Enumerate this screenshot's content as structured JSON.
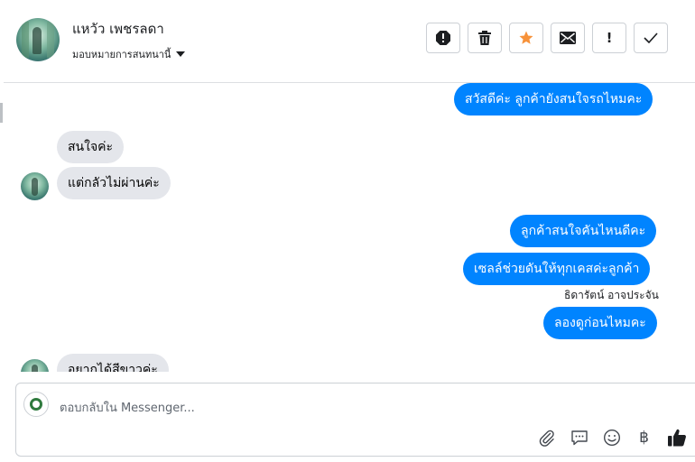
{
  "header": {
    "contact_name": "แหวัว เพชรลดา",
    "assign_label": "มอบหมายการสนทนานี้"
  },
  "actions": [
    {
      "name": "report-icon"
    },
    {
      "name": "trash-icon"
    },
    {
      "name": "star-icon",
      "color": "#f7923a"
    },
    {
      "name": "mail-icon"
    },
    {
      "name": "important-icon",
      "label": "!"
    },
    {
      "name": "check-icon"
    }
  ],
  "messages": {
    "out1": "สวัสดีค่ะ ลูกค้ายังสนใจรถไหมคะ",
    "in1": "สนใจค่ะ",
    "in2": "แต่กลัวไม่ผ่านค่ะ",
    "out2": "ลูกค้าสนใจคันไหนดีคะ",
    "out3": "เซลล์ช่วยดันให้ทุกเคสค่ะลูกค้า",
    "sender": "ธิดารัตน์ อาจประจัน",
    "out4": "ลองดูก่อนไหมคะ",
    "in3": "อยากได้สีขาวค่ะ"
  },
  "composer": {
    "placeholder": "ตอบกลับใน Messenger..."
  },
  "toolbar": {
    "currency_symbol": "฿"
  },
  "colors": {
    "outgoing_bubble": "#0084ff",
    "incoming_bubble": "#e4e6eb"
  }
}
